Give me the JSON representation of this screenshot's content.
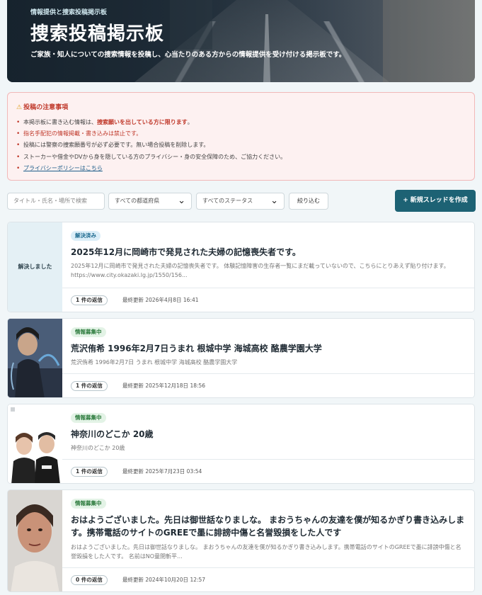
{
  "hero": {
    "eyebrow": "情報提供と捜索投稿掲示板",
    "title": "捜索投稿掲示板",
    "description": "ご家族・知人についての捜索情報を投稿し、心当たりのある方からの情報提供を受け付ける掲示板です。"
  },
  "notice": {
    "heading": "投稿の注意事項",
    "warn_icon": "⚠",
    "items": [
      {
        "before": "本掲示板に書き込む情報は、",
        "highlight": "捜索願いを出している方に限ります",
        "after": "。"
      },
      {
        "text": "指名手配犯の情報掲載・書き込みは禁止です。"
      },
      {
        "text": "投稿には警察の捜索願番号が必ず必要です。無い場合投稿を削除します。"
      },
      {
        "text": "ストーカーや借金やDVから身を隠している方のプライバシー・身の安全保障のため、ご協力ください。"
      },
      {
        "link": "プライバシーポリシーはこちら"
      }
    ]
  },
  "filters": {
    "search_placeholder": "タイトル・氏名・場所で検索",
    "prefecture": "すべての都道府県",
    "status": "すべてのステータス",
    "apply_label": "絞り込む",
    "chevron": "⌄",
    "create_label": "新規スレッドを作成",
    "create_icon": "+"
  },
  "threads": [
    {
      "status": "解決済み",
      "thumb_label": "解決しました",
      "title": "2025年12月に岡崎市で発見された夫婦の記憶喪失者です。",
      "excerpt": "2025年12月に岡崎市で発見された夫婦の記憶喪失者です。 体験記憶障害の生存者一覧にまだ載っていないので、こちらにとりあえず貼り付けます。 https://www.city.okazaki.lg.jp/1550/156...",
      "replies": "1 件の返信",
      "updated": "最終更新 2026年4月8日 16:41"
    },
    {
      "status": "情報募集中",
      "title": "荒沢侑希 1996年2月7日うまれ 根城中学 海城高校 酪農学園大学",
      "excerpt": "荒沢侑希 1996年2月7日 うまれ 根城中学 海城高校 酪農学園大学",
      "replies": "1 件の返信",
      "updated": "最終更新 2025年12月18日 18:56"
    },
    {
      "status": "情報募集中",
      "title": "神奈川のどこか 20歳",
      "excerpt": "神奈川のどこか 20歳",
      "replies": "1 件の返信",
      "updated": "最終更新 2025年7月23日 03:54"
    },
    {
      "status": "情報募集中",
      "title": "おはようございました。先日は御世話なりましな。 まおうちゃんの友達を僕が知るかぎり書き込みします。携帯電話のサイトのGREEで墨に誹謗中傷と名誉毀損をした人です",
      "excerpt": "おはようございました。先日は御世話なりましな。 まおうちゃんの友達を僕が知るかぎり書き込みします。携帯電話のサイトのGREEで墨に誹謗中傷と名誉毀損をした人です。 名前はNO童閉斬平...",
      "replies": "0 件の返信",
      "updated": "最終更新 2024年10月20日 12:57"
    }
  ]
}
